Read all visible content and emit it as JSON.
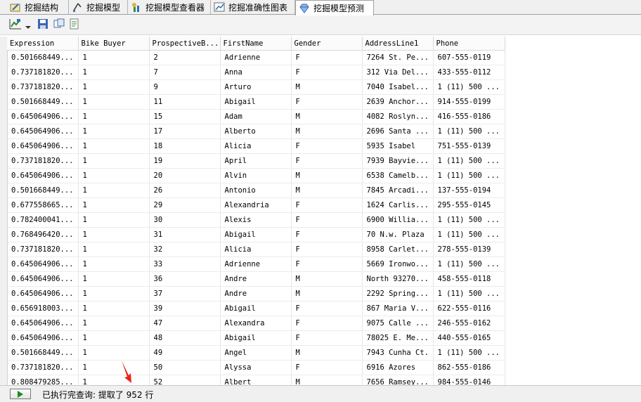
{
  "tabs": [
    {
      "label": "挖掘结构",
      "icon": "structure-icon",
      "active": false
    },
    {
      "label": "挖掘模型",
      "icon": "model-icon",
      "active": false
    },
    {
      "label": "挖掘模型查看器",
      "icon": "viewer-icon",
      "active": false
    },
    {
      "label": "挖掘准确性图表",
      "icon": "chart-icon",
      "active": false
    },
    {
      "label": "挖掘模型预测",
      "icon": "diamond-icon",
      "active": true
    }
  ],
  "toolbar": {
    "icons": [
      "switch-view-icon",
      "dropdown-icon",
      "save-icon",
      "copy-icon",
      "result-icon"
    ]
  },
  "table": {
    "columns": [
      "Expression",
      "Bike Buyer",
      "ProspectiveB...",
      "FirstName",
      "Gender",
      "AddressLine1",
      "Phone"
    ],
    "rows": [
      [
        "0.501668449...",
        "1",
        "2",
        "Adrienne",
        "F",
        "7264 St. Pe...",
        "607-555-0119"
      ],
      [
        "0.737181820...",
        "1",
        "7",
        "Anna",
        "F",
        "312 Via Del...",
        "433-555-0112"
      ],
      [
        "0.737181820...",
        "1",
        "9",
        "Arturo",
        "M",
        "7040 Isabel...",
        "1 (11) 500 ..."
      ],
      [
        "0.501668449...",
        "1",
        "11",
        "Abigail",
        "F",
        "2639 Anchor...",
        "914-555-0199"
      ],
      [
        "0.645064906...",
        "1",
        "15",
        "Adam",
        "M",
        "4082 Roslyn...",
        "416-555-0186"
      ],
      [
        "0.645064906...",
        "1",
        "17",
        "Alberto",
        "M",
        "2696 Santa ...",
        "1 (11) 500 ..."
      ],
      [
        "0.645064906...",
        "1",
        "18",
        "Alicia",
        "F",
        "5935 Isabel",
        "751-555-0139"
      ],
      [
        "0.737181820...",
        "1",
        "19",
        "April",
        "F",
        "7939 Bayvie...",
        "1 (11) 500 ..."
      ],
      [
        "0.645064906...",
        "1",
        "20",
        "Alvin",
        "M",
        "6538 Camelb...",
        "1 (11) 500 ..."
      ],
      [
        "0.501668449...",
        "1",
        "26",
        "Antonio",
        "M",
        "7845 Arcadi...",
        "137-555-0194"
      ],
      [
        "0.677558665...",
        "1",
        "29",
        "Alexandria",
        "F",
        "1624 Carlis...",
        "295-555-0145"
      ],
      [
        "0.782400041...",
        "1",
        "30",
        "Alexis",
        "F",
        "6900 Willia...",
        "1 (11) 500 ..."
      ],
      [
        "0.768496420...",
        "1",
        "31",
        "Abigail",
        "F",
        "70 N.w. Plaza",
        "1 (11) 500 ..."
      ],
      [
        "0.737181820...",
        "1",
        "32",
        "Alicia",
        "F",
        "8958 Carlet...",
        "278-555-0139"
      ],
      [
        "0.645064906...",
        "1",
        "33",
        "Adrienne",
        "F",
        "5669 Ironwo...",
        "1 (11) 500 ..."
      ],
      [
        "0.645064906...",
        "1",
        "36",
        "Andre",
        "M",
        "North 93270...",
        "458-555-0118"
      ],
      [
        "0.645064906...",
        "1",
        "37",
        "Andre",
        "M",
        "2292 Spring...",
        "1 (11) 500 ..."
      ],
      [
        "0.656918003...",
        "1",
        "39",
        "Abigail",
        "F",
        "867 Maria V...",
        "622-555-0116"
      ],
      [
        "0.645064906...",
        "1",
        "47",
        "Alexandra",
        "F",
        "9075 Calle ...",
        "246-555-0162"
      ],
      [
        "0.645064906...",
        "1",
        "48",
        "Abigail",
        "F",
        "78025 E. Me...",
        "440-555-0165"
      ],
      [
        "0.501668449...",
        "1",
        "49",
        "Angel",
        "M",
        "7943 Cunha Ct.",
        "1 (11) 500 ..."
      ],
      [
        "0.737181820...",
        "1",
        "50",
        "Alyssa",
        "F",
        "6916 Azores",
        "862-555-0186"
      ],
      [
        "0.808479285...",
        "1",
        "52",
        "Albert",
        "M",
        "7656 Ramsey...",
        "984-555-0146"
      ]
    ]
  },
  "status": {
    "text": "已执行完查询: 提取了 952 行",
    "run_icon": "play-icon"
  },
  "colors": {
    "arrow": "#e8231a",
    "tab_bar": "#f0f0f0",
    "grid_line": "#e6e6e6"
  }
}
